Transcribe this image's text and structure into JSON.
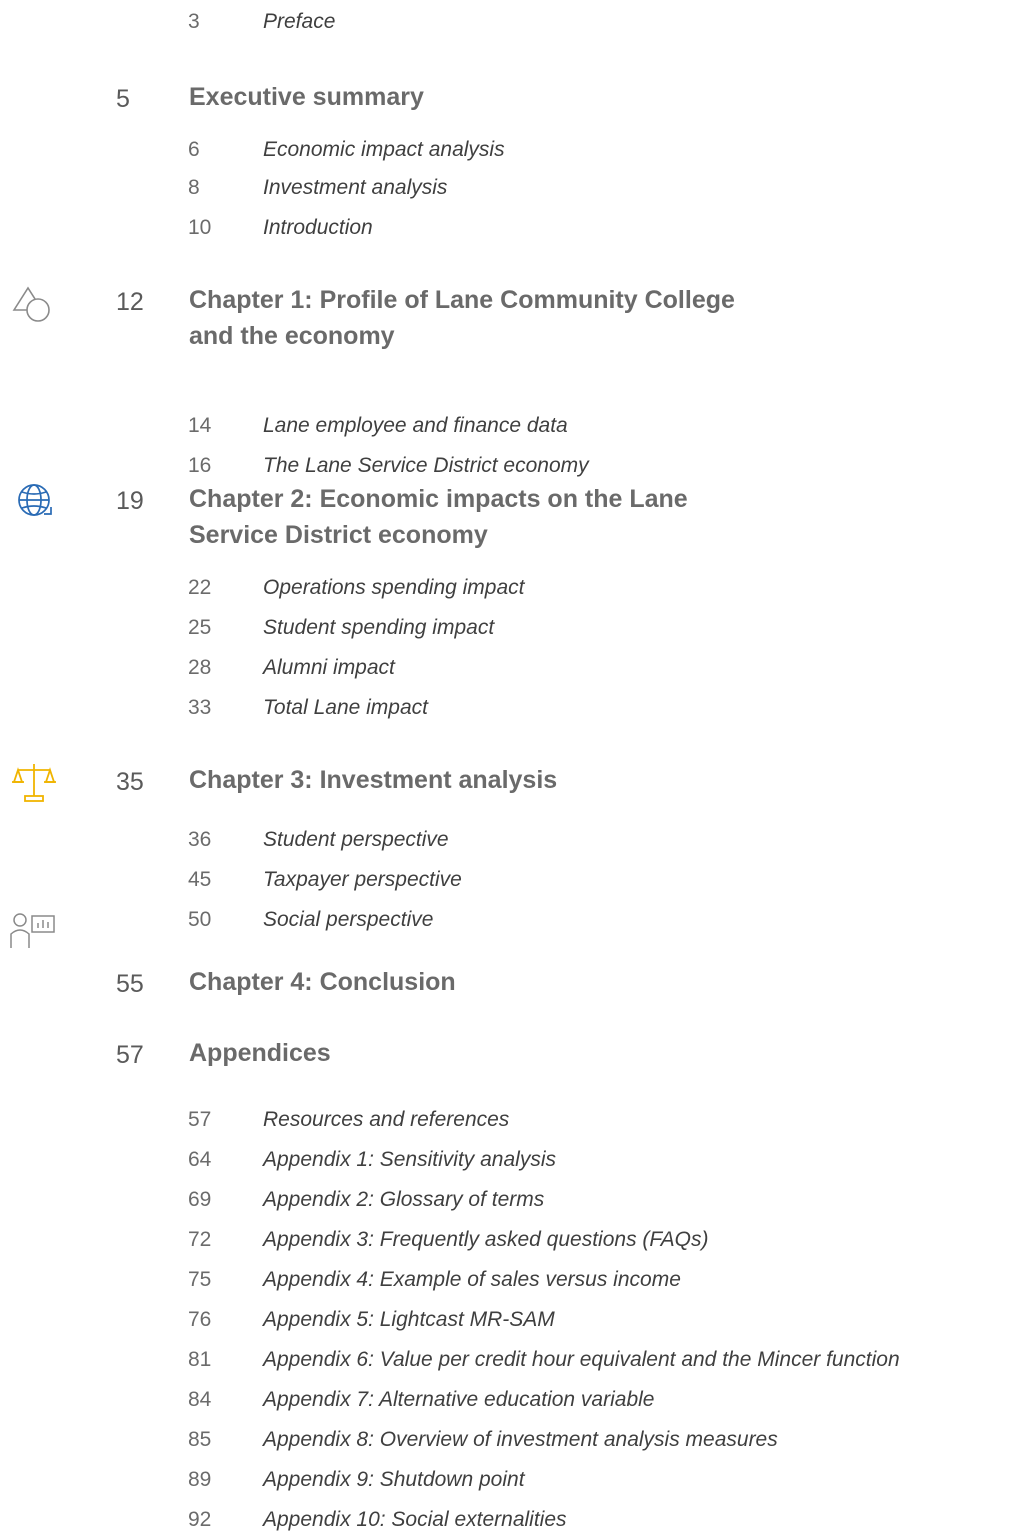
{
  "colors": {
    "globe_icon": "#2a6bb5",
    "scale_icon": "#f0b400",
    "line_icons": "#8a8a8a"
  },
  "toc": [
    {
      "level": "sub",
      "page": "3",
      "title": "Preface"
    },
    {
      "level": "main",
      "page": "5",
      "title": "Executive summary"
    },
    {
      "level": "sub",
      "page": "6",
      "title": "Economic impact analysis"
    },
    {
      "level": "sub",
      "page": "8",
      "title": "Investment analysis"
    },
    {
      "level": "sub",
      "page": "10",
      "title": "Introduction"
    },
    {
      "level": "main",
      "page": "12",
      "title": "Chapter 1:  Profile of Lane Community College and the economy",
      "icon": "shapes-icon"
    },
    {
      "level": "sub",
      "page": "14",
      "title": "Lane employee and finance data"
    },
    {
      "level": "sub",
      "page": "16",
      "title": "The Lane Service District economy"
    },
    {
      "level": "main",
      "page": "19",
      "title": "Chapter 2:  Economic impacts on the Lane Service District economy",
      "icon": "globe-icon"
    },
    {
      "level": "sub",
      "page": "22",
      "title": "Operations spending impact"
    },
    {
      "level": "sub",
      "page": "25",
      "title": "Student spending impact"
    },
    {
      "level": "sub",
      "page": "28",
      "title": "Alumni impact"
    },
    {
      "level": "sub",
      "page": "33",
      "title": "Total Lane impact"
    },
    {
      "level": "main",
      "page": "35",
      "title": "Chapter 3:  Investment analysis",
      "icon": "scale-icon"
    },
    {
      "level": "sub",
      "page": "36",
      "title": "Student perspective"
    },
    {
      "level": "sub",
      "page": "45",
      "title": "Taxpayer perspective"
    },
    {
      "level": "sub",
      "page": "50",
      "title": "Social perspective"
    },
    {
      "level": "main",
      "page": "55",
      "title": "Chapter 4:  Conclusion",
      "icon": "presenter-chart-icon"
    },
    {
      "level": "main",
      "page": "57",
      "title": "Appendices"
    },
    {
      "level": "sub",
      "page": "57",
      "title": "Resources and references"
    },
    {
      "level": "sub",
      "page": "64",
      "title": "Appendix 1:  Sensitivity analysis"
    },
    {
      "level": "sub",
      "page": "69",
      "title": "Appendix 2:  Glossary of terms"
    },
    {
      "level": "sub",
      "page": "72",
      "title": "Appendix 3:  Frequently asked questions (FAQs)"
    },
    {
      "level": "sub",
      "page": "75",
      "title": "Appendix 4:  Example of sales versus income"
    },
    {
      "level": "sub",
      "page": "76",
      "title": "Appendix 5:  Lightcast MR-SAM"
    },
    {
      "level": "sub",
      "page": "81",
      "title": "Appendix 6:  Value per credit hour equivalent and the Mincer function"
    },
    {
      "level": "sub",
      "page": "84",
      "title": "Appendix 7:  Alternative education variable"
    },
    {
      "level": "sub",
      "page": "85",
      "title": "Appendix 8:  Overview of investment analysis measures"
    },
    {
      "level": "sub",
      "page": "89",
      "title": "Appendix 9:  Shutdown point"
    },
    {
      "level": "sub",
      "page": "92",
      "title": "Appendix 10:  Social externalities"
    }
  ]
}
